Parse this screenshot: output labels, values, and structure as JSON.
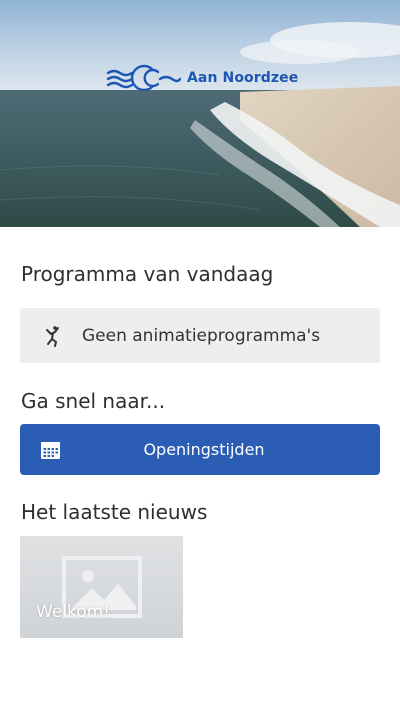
{
  "hero": {
    "brand_name": "Aan Noordzee",
    "logo_icon": "waves-logo-icon"
  },
  "programma": {
    "title": "Programma van vandaag",
    "card_icon": "dancing-person-icon",
    "card_text": "Geen animatieprogramma's"
  },
  "quick_links": {
    "title": "Ga snel naar...",
    "items": [
      {
        "label": "Openingstijden",
        "icon": "calendar-icon"
      }
    ]
  },
  "news": {
    "title": "Het laatste nieuws",
    "items": [
      {
        "title": "Welkom!",
        "image_icon": "image-placeholder-icon"
      }
    ]
  },
  "colors": {
    "brand_blue": "#1e56b4",
    "button_blue": "#2b5db5",
    "card_grey": "#eeeeee",
    "news_placeholder": "#d6d8da"
  }
}
